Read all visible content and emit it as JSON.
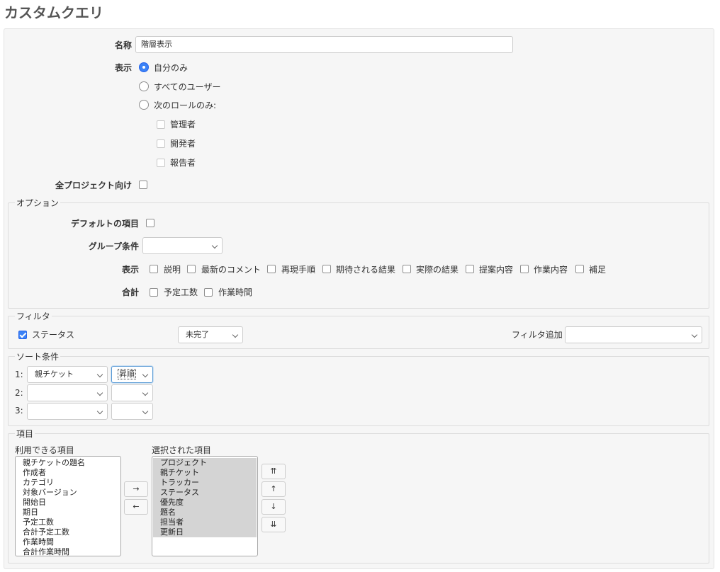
{
  "page_title": "カスタムクエリ",
  "name_field": {
    "label": "名称",
    "value": "階層表示"
  },
  "visibility": {
    "label": "表示",
    "options": [
      "自分のみ",
      "すべてのユーザー",
      "次のロールのみ:"
    ],
    "selected": "自分のみ",
    "roles": [
      "管理者",
      "開発者",
      "報告者"
    ]
  },
  "all_projects": {
    "label": "全プロジェクト向け",
    "checked": false
  },
  "options_section": {
    "legend": "オプション",
    "default_columns_label": "デフォルトの項目",
    "group_by_label": "グループ条件",
    "group_by_value": "",
    "show_label": "表示",
    "show_items": [
      "説明",
      "最新のコメント",
      "再現手順",
      "期待される結果",
      "実際の結果",
      "提案内容",
      "作業内容",
      "補足"
    ],
    "totals_label": "合計",
    "totals_items": [
      "予定工数",
      "作業時間"
    ]
  },
  "filter_section": {
    "legend": "フィルタ",
    "status_label": "ステータス",
    "status_checked": true,
    "status_operator": "未完了",
    "add_filter_label": "フィルタ追加",
    "add_filter_value": ""
  },
  "sort_section": {
    "legend": "ソート条件",
    "rows": [
      {
        "index": "1:",
        "field": "親チケット",
        "order": "昇順"
      },
      {
        "index": "2:",
        "field": "",
        "order": ""
      },
      {
        "index": "3:",
        "field": "",
        "order": ""
      }
    ]
  },
  "columns_section": {
    "legend": "項目",
    "available_label": "利用できる項目",
    "available": [
      "親チケットの題名",
      "作成者",
      "カテゴリ",
      "対象バージョン",
      "開始日",
      "期日",
      "予定工数",
      "合計予定工数",
      "作業時間",
      "合計作業時間"
    ],
    "selected_label": "選択された項目",
    "selected": [
      "プロジェクト",
      "親チケット",
      "トラッカー",
      "ステータス",
      "優先度",
      "題名",
      "担当者",
      "更新日"
    ],
    "move_right": "→",
    "move_left": "←",
    "move_top": "⇈",
    "move_up": "↑",
    "move_down": "↓",
    "move_bottom": "⇊"
  }
}
